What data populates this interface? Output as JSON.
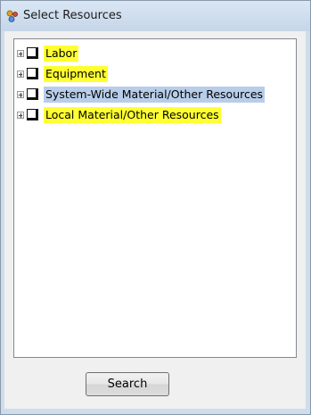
{
  "window": {
    "title": "Select Resources",
    "icon": "resources-app-icon"
  },
  "tree": {
    "items": [
      {
        "label": "Labor",
        "expanded": false,
        "checked": false,
        "highlight": "yellow"
      },
      {
        "label": "Equipment",
        "expanded": false,
        "checked": false,
        "highlight": "yellow"
      },
      {
        "label": "System-Wide Material/Other Resources",
        "expanded": false,
        "checked": false,
        "highlight": "blue"
      },
      {
        "label": "Local Material/Other Resources",
        "expanded": false,
        "checked": false,
        "highlight": "yellow"
      }
    ]
  },
  "actions": {
    "search_label": "Search"
  },
  "colors": {
    "highlight_yellow": "#ffff33",
    "highlight_blue": "#b8cde9",
    "titlebar": "#cfdcea"
  }
}
